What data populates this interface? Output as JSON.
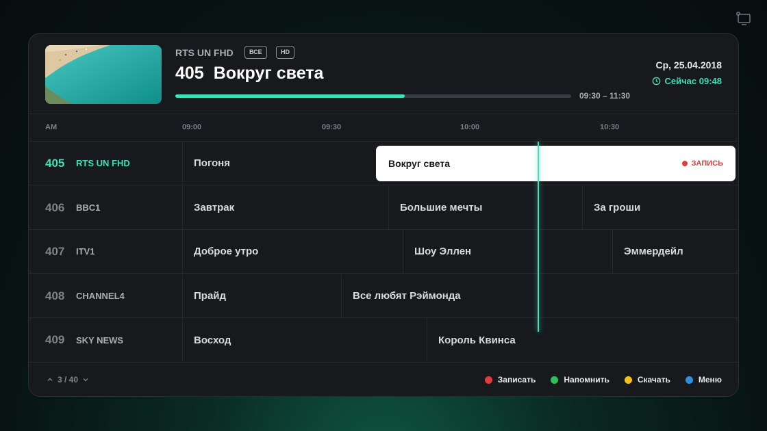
{
  "header": {
    "channel_name": "RTS UN FHD",
    "badges": [
      "ВСЕ",
      "HD"
    ],
    "program_number": "405",
    "program_title": "Вокруг света",
    "progress": 0.58,
    "time_range": "09:30 – 11:30",
    "date": "Ср, 25.04.2018",
    "now_label": "Сейчас 09:48",
    "accent_color": "#3de0b7"
  },
  "timeline": {
    "period": "AM",
    "ticks": [
      "09:00",
      "09:30",
      "10:00",
      "10:30"
    ]
  },
  "rows": [
    {
      "number": "405",
      "channel": "RTS UN FHD",
      "active": true,
      "programs": [
        "Погоня"
      ],
      "focused": {
        "title": "Вокруг света",
        "record_label": "ЗАПИСЬ"
      }
    },
    {
      "number": "406",
      "channel": "BBC1",
      "programs": [
        "Завтрак",
        "Большие мечты",
        "За гроши"
      ]
    },
    {
      "number": "407",
      "channel": "ITV1",
      "programs": [
        "Доброе утро",
        "Шоу Эллен",
        "Эммердейл"
      ]
    },
    {
      "number": "408",
      "channel": "CHANNEL4",
      "programs": [
        "Прайд",
        "Все любят Рэймонда"
      ]
    },
    {
      "number": "409",
      "channel": "SKY NEWS",
      "programs": [
        "Восход",
        "Король Квинса"
      ]
    }
  ],
  "footer": {
    "pager": "3 / 40",
    "legend": [
      {
        "label": "Записать",
        "color": "#e23b3b"
      },
      {
        "label": "Напомнить",
        "color": "#2fbf5b"
      },
      {
        "label": "Скачать",
        "color": "#f2c21a"
      },
      {
        "label": "Меню",
        "color": "#2f8fe0"
      }
    ]
  }
}
